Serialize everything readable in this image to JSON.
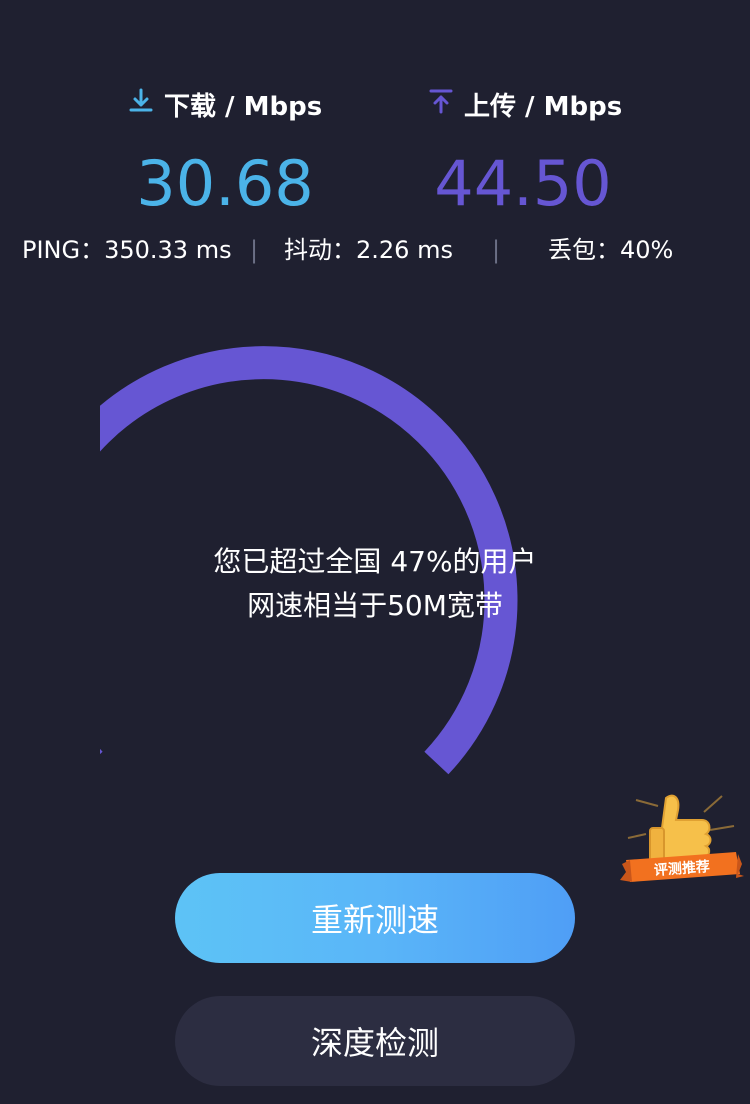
{
  "download": {
    "label": "下载 / Mbps",
    "value": "30.68",
    "color": "#4bb3e8",
    "icon": "download-arrow-icon"
  },
  "upload": {
    "label": "上传 / Mbps",
    "value": "44.50",
    "color": "#6656d3",
    "icon": "upload-arrow-icon"
  },
  "stats": {
    "ping": "PING：350.33 ms",
    "separator_1": "|",
    "jitter": "抖动：2.26 ms",
    "separator_2": "|",
    "packet_loss": "丢包：40%"
  },
  "gauge": {
    "line1": "您已超过全国 47%的用户",
    "line2": "网速相当于50M宽带",
    "color": "#6656d3"
  },
  "badge": {
    "text": "评测推荐",
    "icon": "thumbs-up-icon"
  },
  "buttons": {
    "retest": "重新测速",
    "deep_check": "深度检测"
  }
}
